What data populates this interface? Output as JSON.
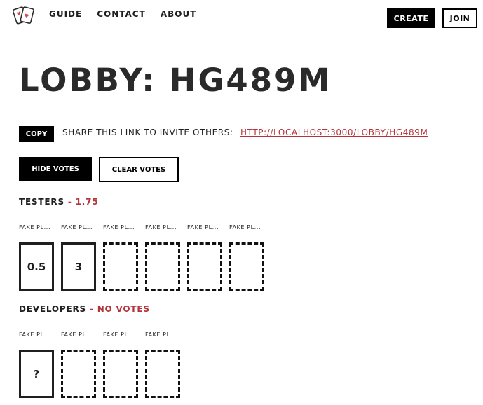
{
  "nav": {
    "items": [
      "Guide",
      "Contact",
      "About"
    ],
    "create_label": "Create",
    "join_label": "Join"
  },
  "lobby": {
    "title": "Lobby: HG489M",
    "copy_label": "Copy",
    "share_text": "Share this link to invite others:",
    "share_link": "http://localhost:3000/lobby/HG489M",
    "hide_votes_label": "Hide votes",
    "clear_votes_label": "Clear votes"
  },
  "groups": [
    {
      "name": "Testers",
      "separator": "-",
      "stat": "1.75",
      "players": [
        {
          "name": "Fake Pl...",
          "vote": "0.5"
        },
        {
          "name": "Fake Pl...",
          "vote": "3"
        },
        {
          "name": "Fake Pl...",
          "vote": ""
        },
        {
          "name": "Fake Pl...",
          "vote": ""
        },
        {
          "name": "Fake Pl...",
          "vote": ""
        },
        {
          "name": "Fake Pl...",
          "vote": ""
        }
      ]
    },
    {
      "name": "Developers",
      "separator": "-",
      "stat": "No votes",
      "players": [
        {
          "name": "Fake Pl...",
          "vote": "?"
        },
        {
          "name": "Fake Pl...",
          "vote": ""
        },
        {
          "name": "Fake Pl...",
          "vote": ""
        },
        {
          "name": "Fake Pl...",
          "vote": ""
        }
      ]
    }
  ],
  "colors": {
    "accent": "#b5343a",
    "ink": "#1f1f1f"
  },
  "icons": {
    "logo": "playing-cards-icon"
  }
}
